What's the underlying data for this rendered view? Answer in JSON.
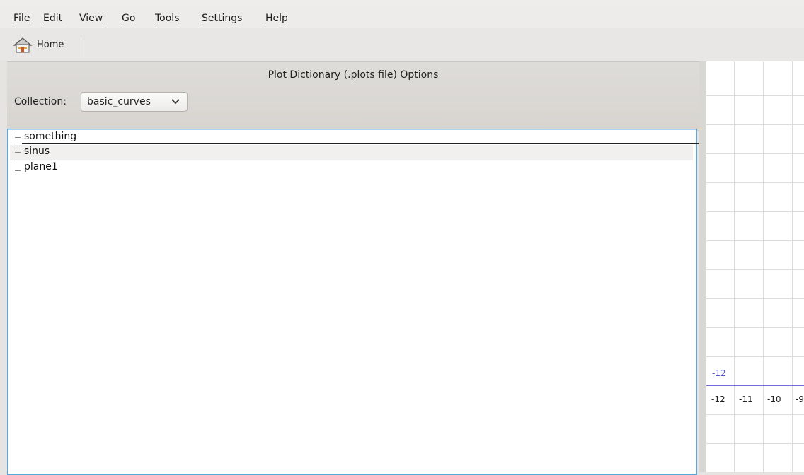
{
  "menu": {
    "items": [
      "File",
      "Edit",
      "View",
      "Go",
      "Tools",
      "Settings",
      "Help"
    ]
  },
  "toolbar": {
    "home_label": "Home",
    "home_icon": "home-icon"
  },
  "panel": {
    "title": "Plot Dictionary (.plots file) Options",
    "collection_label": "Collection:",
    "collection_value": "basic_curves"
  },
  "tree": {
    "items": [
      {
        "label": "something"
      },
      {
        "label": "sinus"
      },
      {
        "label": "plane1"
      }
    ],
    "hovered_item": "sinus"
  },
  "plot": {
    "y_axis_label_value": "-12",
    "x_ticks": [
      "-12",
      "-11",
      "-10",
      "-9"
    ],
    "axis_color": "#6f6fde",
    "grid_color": "#dcdcdc"
  },
  "colors": {
    "focus_border": "#58a7dd",
    "window_bg": "#e6e4e2"
  }
}
